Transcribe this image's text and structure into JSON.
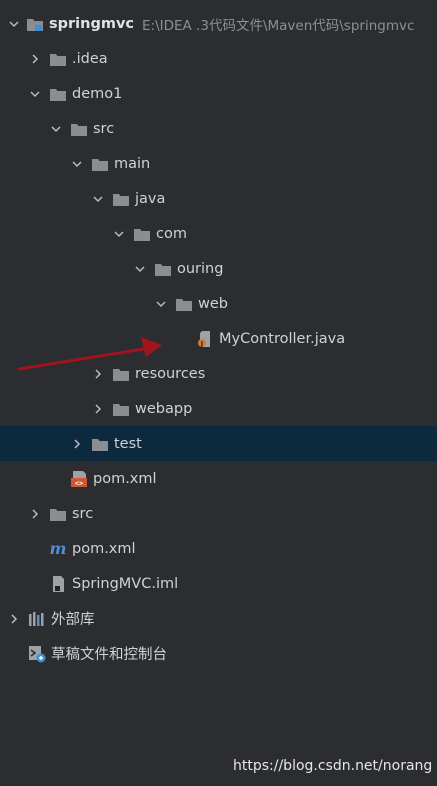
{
  "project": {
    "name": "springmvc",
    "path": "E:\\IDEA .3代码文件\\Maven代码\\springmvc"
  },
  "tree": [
    {
      "key": "idea",
      "label": ".idea",
      "level": 1,
      "expanded": false,
      "icon": "folder",
      "chevron": true
    },
    {
      "key": "demo1",
      "label": "demo1",
      "level": 1,
      "expanded": true,
      "icon": "folder",
      "chevron": true
    },
    {
      "key": "demo1-src",
      "label": "src",
      "level": 2,
      "expanded": true,
      "icon": "folder",
      "chevron": true
    },
    {
      "key": "main",
      "label": "main",
      "level": 3,
      "expanded": true,
      "icon": "folder",
      "chevron": true
    },
    {
      "key": "java",
      "label": "java",
      "level": 4,
      "expanded": true,
      "icon": "folder",
      "chevron": true
    },
    {
      "key": "com",
      "label": "com",
      "level": 5,
      "expanded": true,
      "icon": "folder",
      "chevron": true
    },
    {
      "key": "ouring",
      "label": "ouring",
      "level": 6,
      "expanded": true,
      "icon": "folder",
      "chevron": true
    },
    {
      "key": "web",
      "label": "web",
      "level": 7,
      "expanded": true,
      "icon": "folder",
      "chevron": true
    },
    {
      "key": "mycontroller",
      "label": "MyController.java",
      "level": 8,
      "icon": "java-file",
      "chevron": false
    },
    {
      "key": "resources",
      "label": "resources",
      "level": 4,
      "expanded": false,
      "icon": "folder",
      "chevron": true
    },
    {
      "key": "webapp",
      "label": "webapp",
      "level": 4,
      "expanded": false,
      "icon": "folder",
      "chevron": true
    },
    {
      "key": "test",
      "label": "test",
      "level": 3,
      "expanded": false,
      "icon": "folder",
      "chevron": true,
      "selected": true
    },
    {
      "key": "demo1-pom",
      "label": "pom.xml",
      "level": 2,
      "icon": "maven-xml",
      "chevron": false
    },
    {
      "key": "root-src",
      "label": "src",
      "level": 1,
      "expanded": false,
      "icon": "folder",
      "chevron": true
    },
    {
      "key": "root-pom",
      "label": "pom.xml",
      "level": 1,
      "icon": "maven-m",
      "chevron": false
    },
    {
      "key": "iml",
      "label": "SpringMVC.iml",
      "level": 1,
      "icon": "iml-file",
      "chevron": false
    },
    {
      "key": "external-libs",
      "label": "外部库",
      "level": 0,
      "expanded": false,
      "icon": "library",
      "chevron": true
    },
    {
      "key": "scratches",
      "label": "草稿文件和控制台",
      "level": 0,
      "icon": "scratch",
      "chevron": false
    }
  ],
  "watermark": "https://blog.csdn.net/norang",
  "colors": {
    "background": "#2b2d30",
    "selection": "#0d293e",
    "folder": "#8a8d91",
    "text": "#cfd2d6",
    "arrow": "#a0141e",
    "maven": "#d0582e",
    "maven_m": "#4f8fd6",
    "java_badge": "#d97a34"
  }
}
